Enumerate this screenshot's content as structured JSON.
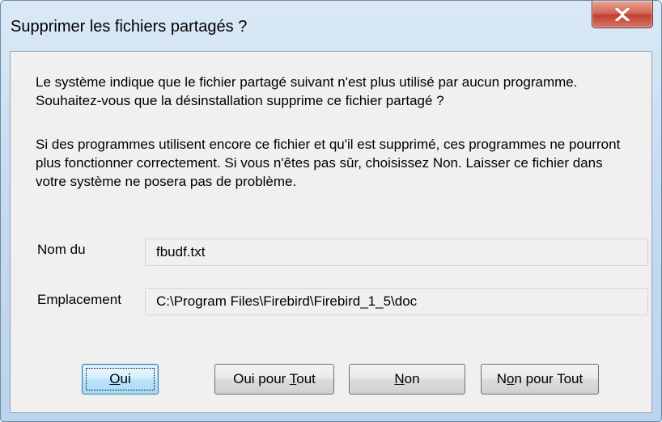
{
  "window": {
    "title": "Supprimer les fichiers partagés ?"
  },
  "message": {
    "paragraph1": "Le système indique que le fichier partagé suivant n'est plus utilisé par aucun programme. Souhaitez-vous que la désinstallation supprime ce fichier partagé ?",
    "paragraph2": "Si des programmes utilisent encore ce fichier et qu'il est supprimé, ces programmes ne pourront plus fonctionner correctement. Si vous n'êtes pas sûr, choisissez Non. Laisser ce fichier dans votre système ne posera pas de problème."
  },
  "fields": {
    "name_label": "Nom du",
    "name_value": "fbudf.txt",
    "location_label": "Emplacement",
    "location_value": "C:\\Program Files\\Firebird\\Firebird_1_5\\doc"
  },
  "buttons": {
    "yes": {
      "accel": "O",
      "rest": "ui"
    },
    "yes_all": {
      "before": "Oui pour ",
      "accel": "T",
      "after": "out"
    },
    "no": {
      "accel": "N",
      "rest": "on"
    },
    "no_all": {
      "before": "N",
      "accel": "o",
      "after": "n pour Tout"
    }
  },
  "icons": {
    "close": "close-icon"
  },
  "colors": {
    "client_bg": "#f0f0f0",
    "close_button": "#c13f2e",
    "default_button_border": "#3c7fb1"
  }
}
